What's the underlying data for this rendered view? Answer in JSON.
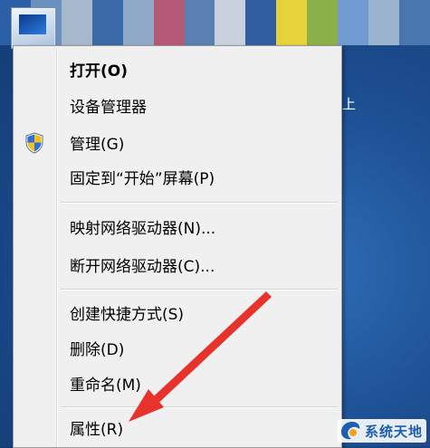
{
  "background_color": "#1d4f93",
  "mosaic_colors": [
    "#2b5fa6",
    "#6b8fbf",
    "#a8b8cc",
    "#3a6aa8",
    "#90a9c8",
    "#b45a78",
    "#5a7fb0",
    "#c9d2dc",
    "#2f5f9e",
    "#e6d23a",
    "#8ab04a",
    "#6f9bd0",
    "#9ab3cf",
    "#4a76b0"
  ],
  "desktop": {
    "right_edge_text": "上"
  },
  "context_menu": {
    "items": [
      {
        "label": "打开(O)",
        "bold": true,
        "icon": null
      },
      {
        "label": "设备管理器",
        "bold": false,
        "icon": null
      },
      {
        "label": "管理(G)",
        "bold": false,
        "icon": "uac-shield-icon"
      },
      {
        "label": "固定到“开始”屏幕(P)",
        "bold": false,
        "icon": null
      },
      {
        "label": "映射网络驱动器(N)...",
        "bold": false,
        "icon": null
      },
      {
        "label": "断开网络驱动器(C)...",
        "bold": false,
        "icon": null
      },
      {
        "label": "创建快捷方式(S)",
        "bold": false,
        "icon": null
      },
      {
        "label": "删除(D)",
        "bold": false,
        "icon": null
      },
      {
        "label": "重命名(M)",
        "bold": false,
        "icon": null
      },
      {
        "label": "属性(R)",
        "bold": false,
        "icon": null
      }
    ],
    "separators_after": [
      3,
      5,
      8
    ]
  },
  "annotation": {
    "arrow_color": "#e8322c",
    "points_to": "属性(R)"
  },
  "watermark": {
    "text": "系统天地",
    "accent_color": "#1b5fae"
  }
}
